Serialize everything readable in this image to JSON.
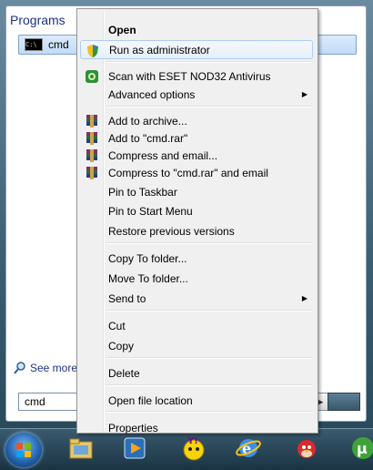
{
  "start_menu": {
    "programs_header": "Programs",
    "program_item": "cmd",
    "cmd_icon_text": "C:\\",
    "see_more": "See more",
    "search_value": "cmd"
  },
  "context_menu": {
    "items": [
      {
        "label": "Open",
        "bold": true,
        "icon": null
      },
      {
        "label": "Run as administrator",
        "icon": "shield-icon"
      },
      {
        "label": "Scan with ESET NOD32 Antivirus",
        "icon": "eset-icon"
      },
      {
        "label": "Advanced options",
        "submenu": true
      },
      {
        "label": "Add to archive...",
        "icon": "winrar-icon"
      },
      {
        "label": "Add to \"cmd.rar\"",
        "icon": "winrar-icon"
      },
      {
        "label": "Compress and email...",
        "icon": "winrar-icon"
      },
      {
        "label": "Compress to \"cmd.rar\" and email",
        "icon": "winrar-icon"
      },
      {
        "label": "Pin to Taskbar"
      },
      {
        "label": "Pin to Start Menu"
      },
      {
        "label": "Restore previous versions"
      },
      {
        "label": "Copy To folder..."
      },
      {
        "label": "Move To folder..."
      },
      {
        "label": "Send to",
        "submenu": true
      },
      {
        "label": "Cut"
      },
      {
        "label": "Copy"
      },
      {
        "label": "Delete"
      },
      {
        "label": "Open file location"
      },
      {
        "label": "Properties"
      }
    ]
  },
  "taskbar": {
    "icons": [
      "windows-start-orb",
      "file-explorer-icon",
      "media-player-icon",
      "yahoo-messenger-icon",
      "internet-explorer-icon",
      "angry-birds-icon",
      "utorrent-icon"
    ]
  },
  "colors": {
    "highlight_border": "#aeccf1",
    "menu_bg": "#f0f0f0",
    "header_text": "#1e3287"
  }
}
